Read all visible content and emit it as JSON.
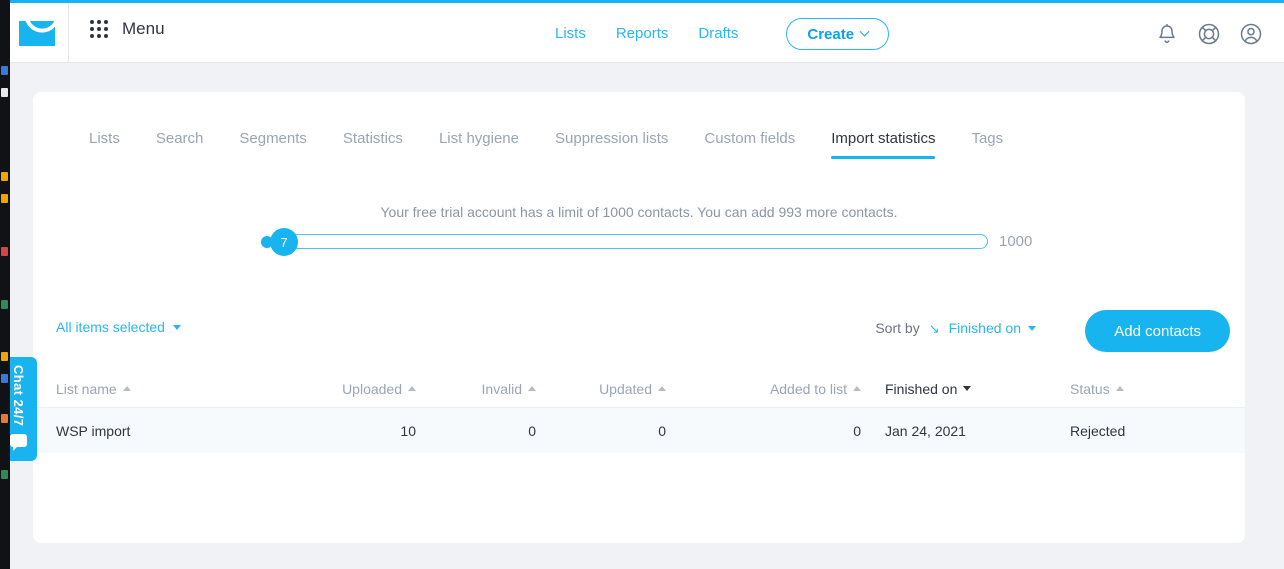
{
  "header": {
    "logo_icon": "envelope-logo-icon",
    "menu_icon": "grid-menu-icon",
    "menu_label": "Menu",
    "nav_links": [
      {
        "label": "Lists"
      },
      {
        "label": "Reports"
      },
      {
        "label": "Drafts"
      }
    ],
    "create_label": "Create",
    "icons": [
      {
        "name": "notifications-bell-icon"
      },
      {
        "name": "help-lifebuoy-icon"
      },
      {
        "name": "user-account-icon"
      }
    ]
  },
  "tabs": [
    {
      "label": "Lists",
      "active": false
    },
    {
      "label": "Search",
      "active": false
    },
    {
      "label": "Segments",
      "active": false
    },
    {
      "label": "Statistics",
      "active": false
    },
    {
      "label": "List hygiene",
      "active": false
    },
    {
      "label": "Suppression lists",
      "active": false
    },
    {
      "label": "Custom fields",
      "active": false
    },
    {
      "label": "Import statistics",
      "active": true
    },
    {
      "label": "Tags",
      "active": false
    }
  ],
  "trial": {
    "notice": "Your free trial account has a limit of 1000 contacts. You can add 993 more contacts.",
    "current_value": "7",
    "max_value": "1000"
  },
  "toolbar": {
    "selection_label": "All items selected",
    "sort_by_label": "Sort by",
    "sort_direction_glyph": "↘",
    "sort_value": "Finished on",
    "add_contacts_label": "Add contacts"
  },
  "table": {
    "columns": [
      {
        "label": "List name",
        "sort": "asc",
        "active": false
      },
      {
        "label": "Uploaded",
        "sort": "asc",
        "active": false
      },
      {
        "label": "Invalid",
        "sort": "asc",
        "active": false
      },
      {
        "label": "Updated",
        "sort": "asc",
        "active": false
      },
      {
        "label": "Added to list",
        "sort": "asc",
        "active": false
      },
      {
        "label": "Finished on",
        "sort": "desc",
        "active": true
      },
      {
        "label": "Status",
        "sort": "asc",
        "active": false
      }
    ],
    "rows": [
      {
        "list_name": "WSP import",
        "uploaded": "10",
        "invalid": "0",
        "updated": "0",
        "added_to_list": "0",
        "finished_on": "Jan 24, 2021",
        "status": "Rejected"
      }
    ]
  },
  "chat": {
    "label": "Chat 24/7",
    "icon": "speech-bubble-icon"
  },
  "colors": {
    "accent": "#18b4f0",
    "link": "#29b6f6",
    "page_bg": "#f1f2f6",
    "card_bg": "#ffffff",
    "muted_text": "#9aa5b4",
    "dark_text": "#2f3640"
  }
}
